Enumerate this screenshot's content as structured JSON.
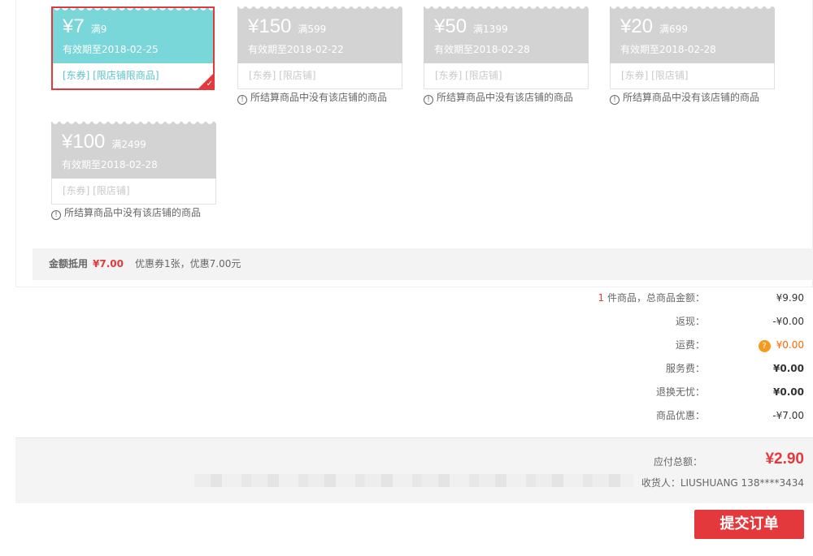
{
  "coupons": [
    {
      "price": "¥7",
      "limit": "满9",
      "expire": "有效期至2018-02-25",
      "tags": "[东券]  [限店铺限商品]",
      "selected": true,
      "note": ""
    },
    {
      "price": "¥150",
      "limit": "满599",
      "expire": "有效期至2018-02-22",
      "tags": "[东券]  [限店铺]",
      "selected": false,
      "note": "所结算商品中没有该店铺的商品"
    },
    {
      "price": "¥50",
      "limit": "满1399",
      "expire": "有效期至2018-02-28",
      "tags": "[东券]  [限店铺]",
      "selected": false,
      "note": "所结算商品中没有该店铺的商品"
    },
    {
      "price": "¥20",
      "limit": "满699",
      "expire": "有效期至2018-02-28",
      "tags": "[东券]  [限店铺]",
      "selected": false,
      "note": "所结算商品中没有该店铺的商品"
    },
    {
      "price": "¥100",
      "limit": "满2499",
      "expire": "有效期至2018-02-28",
      "tags": "[东券]  [限店铺]",
      "selected": false,
      "note": "所结算商品中没有该店铺的商品"
    }
  ],
  "coupon_summary": {
    "label": "金额抵用",
    "amount": "¥7.00",
    "desc": "优惠券1张，优惠7.00元"
  },
  "totals": {
    "count": "1",
    "count_suffix": " 件商品，总商品金额：",
    "goods_value": "¥9.90",
    "cashback_label": "返现：",
    "cashback_value": "-¥0.00",
    "shipping_label": "运费：",
    "shipping_value": "¥0.00",
    "service_label": "服务费：",
    "service_value": "¥0.00",
    "return_label": "退换无忧：",
    "return_value": "¥0.00",
    "discount_label": "商品优惠：",
    "discount_value": "-¥7.00"
  },
  "payment": {
    "due_label": "应付总额：",
    "due_value": "¥2.90",
    "receiver": "收货人：LIUSHUANG 138****3434"
  },
  "submit_label": "提交订单",
  "icons": {
    "warning": "!",
    "help": "?",
    "check": "✓"
  }
}
